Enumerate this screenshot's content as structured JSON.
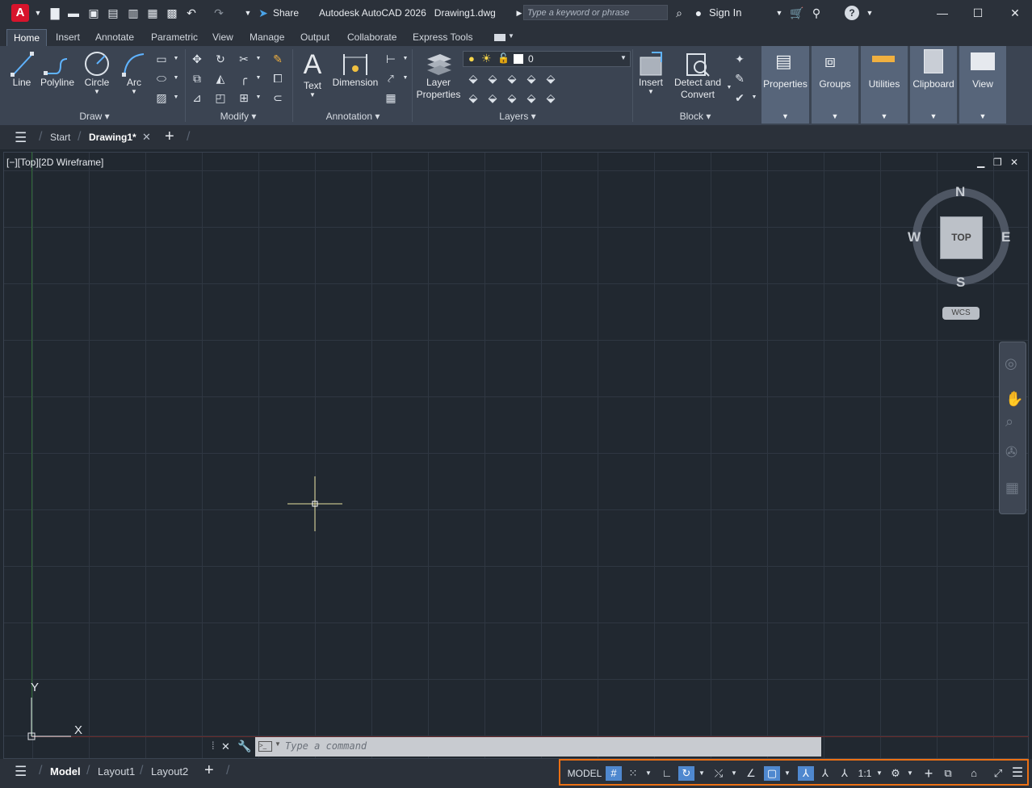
{
  "titlebar": {
    "app_letter": "A",
    "share_label": "Share",
    "app_title": "Autodesk AutoCAD 2026",
    "file_name": "Drawing1.dwg",
    "search_placeholder": "Type a keyword or phrase",
    "sign_in_label": "Sign In"
  },
  "ribbon_tabs": [
    "Home",
    "Insert",
    "Annotate",
    "Parametric",
    "View",
    "Manage",
    "Output",
    "Collaborate",
    "Express Tools"
  ],
  "ribbon": {
    "draw": {
      "title": "Draw",
      "line": "Line",
      "polyline": "Polyline",
      "circle": "Circle",
      "arc": "Arc"
    },
    "modify": {
      "title": "Modify"
    },
    "annotation": {
      "title": "Annotation",
      "text": "Text",
      "dimension": "Dimension"
    },
    "layers": {
      "title": "Layers",
      "layer_properties": "Layer Properties",
      "current_layer": "0"
    },
    "block": {
      "title": "Block",
      "insert": "Insert",
      "detect_convert": "Detect and Convert"
    },
    "tiles": {
      "properties": "Properties",
      "groups": "Groups",
      "utilities": "Utilities",
      "clipboard": "Clipboard",
      "view": "View"
    }
  },
  "file_tabs": {
    "start": "Start",
    "drawing": "Drawing1*"
  },
  "viewport": {
    "label": "[−][Top][2D Wireframe]",
    "ucs_y": "Y",
    "ucs_x": "X"
  },
  "viewcube": {
    "face": "TOP",
    "north": "N",
    "south": "S",
    "east": "E",
    "west": "W",
    "wcs": "WCS"
  },
  "command": {
    "placeholder": "Type a command"
  },
  "layout_tabs": [
    "Model",
    "Layout1",
    "Layout2"
  ],
  "status": {
    "model": "MODEL",
    "scale": "1:1"
  },
  "colors": {
    "accent": "#4f88cf",
    "status_highlight": "#ec7014",
    "logo": "#d7142c"
  }
}
